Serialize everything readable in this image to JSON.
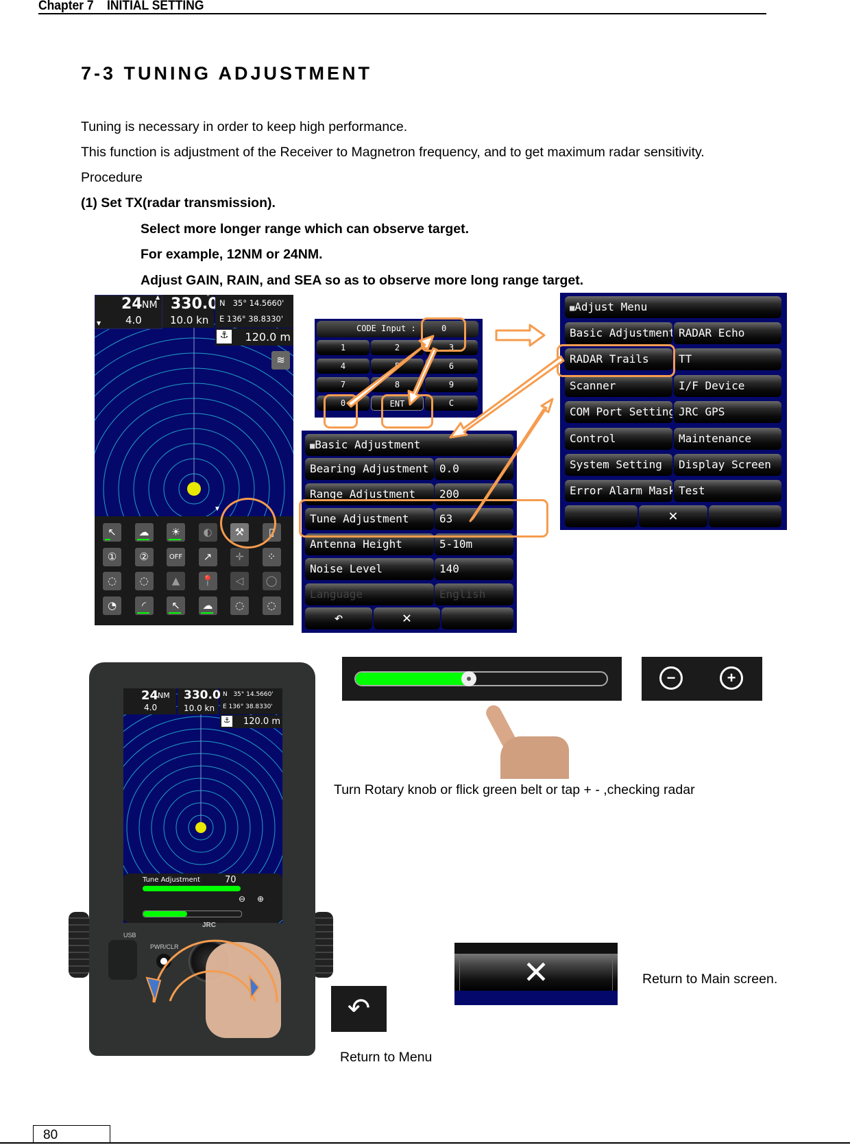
{
  "header": {
    "chapter": "Chapter 7    INITIAL SETTING"
  },
  "section": {
    "title": "7-3 TUNING ADJUSTMENT"
  },
  "body": {
    "line1": "Tuning is necessary in order to keep high performance.",
    "line2": "This function is adjustment of the Receiver to Magnetron frequency, and to get maximum radar sensitivity.",
    "procedure": "Procedure",
    "step1": "(1) Set TX(radar transmission).",
    "step1_sub1": "Select more longer range which can observe target.",
    "step1_sub2": "For example, 12NM or 24NM.",
    "step1_sub3": "Adjust GAIN, RAIN, and SEA so as to observe more long range target."
  },
  "radar_display": {
    "range": "24",
    "range_unit": "NM",
    "ring_interval": "4.0",
    "heading": "330.0",
    "heading_unit": "°",
    "speed": "10.0 kn",
    "lat": "N   35° 14.5660'",
    "lon": "E 136° 38.8330'",
    "depth": "120.0 m",
    "icons": [
      [
        "gain-icon",
        "rain-icon",
        "brightness-icon",
        "dimmer-icon",
        "maintenance-menu-icon",
        "window-icon"
      ],
      [
        "user-1-icon",
        "user-2-icon",
        "own-ship-off-icon",
        "ebl-vrm-icon",
        "cursor-icon",
        "target-tracking-icon"
      ],
      [
        "vrm-1-icon",
        "vrm-2-icon",
        "heading-icon",
        "waypoint-icon",
        "ebl-icon",
        "guard-zone-icon"
      ],
      [
        "radar-icon",
        "curve-icon",
        "sea-icon",
        "rain-2-icon",
        "vrm-3-icon",
        "vrm-4-icon"
      ]
    ]
  },
  "code_input": {
    "label": "CODE Input :",
    "value": "0",
    "keys": [
      "1",
      "2",
      "3",
      "4",
      "5",
      "6",
      "7",
      "8",
      "9",
      "0",
      "ENT",
      "C"
    ]
  },
  "adjust_menu": {
    "title": "Adjust Menu",
    "items": [
      [
        "Basic Adjustment",
        "RADAR Echo"
      ],
      [
        "RADAR Trails",
        "TT"
      ],
      [
        "Scanner",
        "I/F Device"
      ],
      [
        "COM Port Setting",
        "JRC GPS"
      ],
      [
        "Control",
        "Maintenance"
      ],
      [
        "System Setting",
        "Display Screen"
      ],
      [
        "Error Alarm Mask",
        "Test"
      ]
    ],
    "close_symbol": "✕"
  },
  "basic_adjustment": {
    "title": "Basic Adjustment",
    "rows": [
      {
        "label": "Bearing Adjustment",
        "value": "0.0"
      },
      {
        "label": "Range Adjustment",
        "value": "200"
      },
      {
        "label": "Tune Adjustment",
        "value": "63"
      },
      {
        "label": "Antenna Height",
        "value": "5-10m"
      },
      {
        "label": "Noise Level",
        "value": "140"
      },
      {
        "label": "Language",
        "value": "English",
        "disabled": true
      }
    ],
    "back_symbol": "↶",
    "close_symbol": "✕"
  },
  "device": {
    "tune_label": "Tune Adjustment",
    "tune_value": "70",
    "usb_label": "USB",
    "pwr_label": "PWR/CLR",
    "brand": "JRC"
  },
  "slider": {
    "fill_fraction": 0.45,
    "minus_symbol": "−",
    "plus_symbol": "+"
  },
  "captions": {
    "rotary": "Turn Rotary knob or flick green belt or tap + - ,checking radar",
    "return_main": "Return to Main screen.",
    "return_menu": "Return to Menu"
  },
  "colors": {
    "radar_bg": "#05086b",
    "ring": "#1fa0c8",
    "accent_orange": "#f59c4e",
    "slider_green": "#00ff00"
  },
  "footer": {
    "page": "80"
  }
}
